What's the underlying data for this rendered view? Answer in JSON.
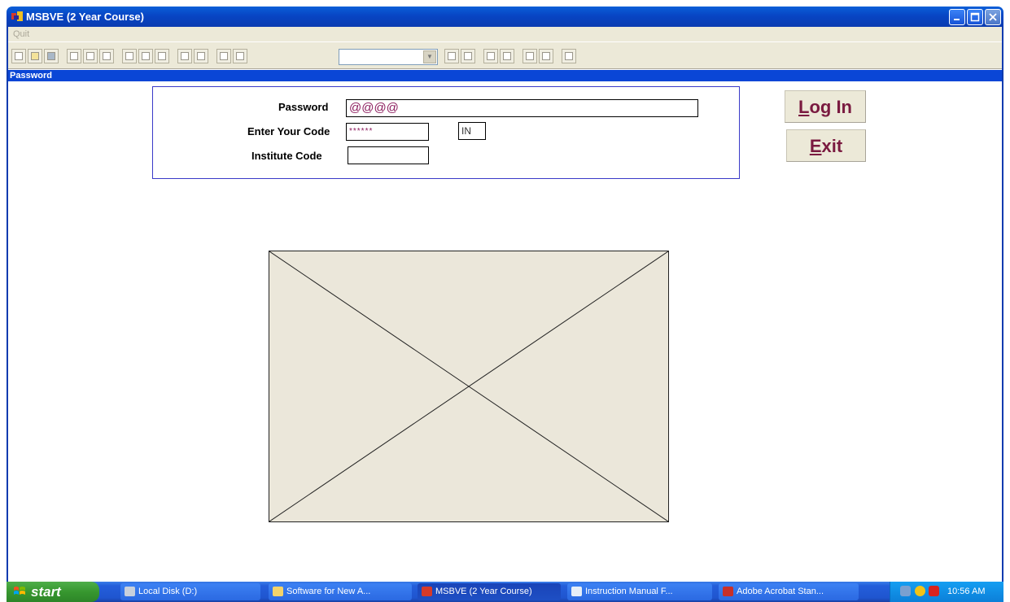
{
  "window": {
    "title": "MSBVE (2 Year Course)"
  },
  "menu": {
    "items": [
      "Quit"
    ]
  },
  "toolbar": {
    "combo_value": ""
  },
  "child_window": {
    "title": "Password"
  },
  "form": {
    "password_label": "Password",
    "password_value": "@@@@",
    "code_label": "Enter Your Code",
    "code_value": "******",
    "code_suffix": "IN",
    "institute_label": "Institute Code",
    "institute_value": ""
  },
  "buttons": {
    "login_label_first": "L",
    "login_label_rest": "og In",
    "exit_label_first": "E",
    "exit_label_rest": "xit"
  },
  "taskbar": {
    "start_label": "start",
    "tasks": [
      {
        "label": "Local Disk (D:)",
        "icon": "drive-icon"
      },
      {
        "label": "Software for New A...",
        "icon": "folder-icon"
      },
      {
        "label": "MSBVE (2 Year Course)",
        "icon": "app-icon"
      },
      {
        "label": "Instruction Manual F...",
        "icon": "document-icon"
      },
      {
        "label": "Adobe Acrobat Stan...",
        "icon": "acrobat-icon"
      }
    ],
    "clock": "10:56 AM"
  }
}
